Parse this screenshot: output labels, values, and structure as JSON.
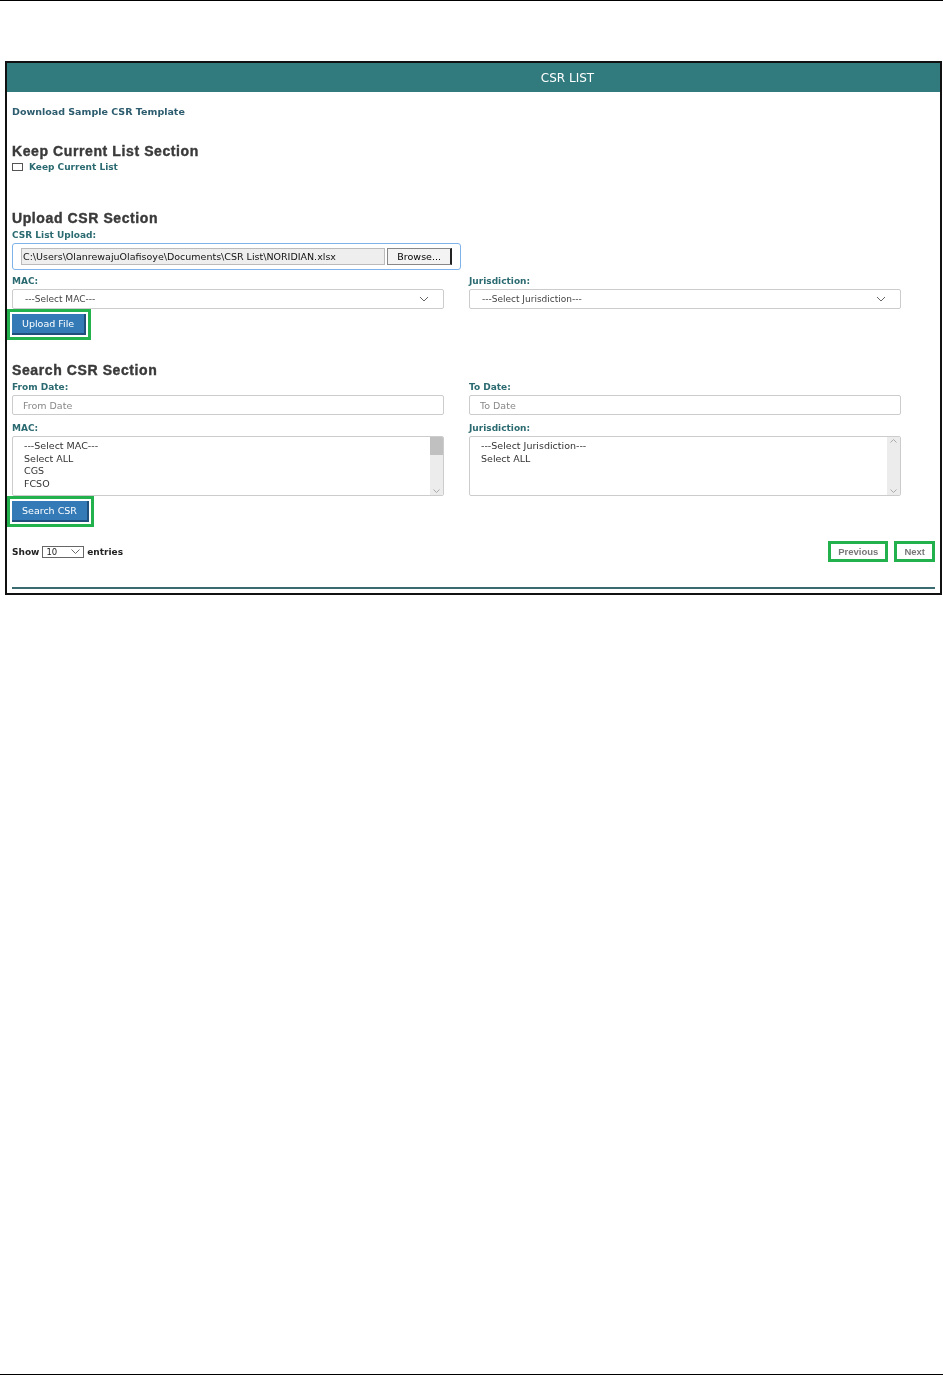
{
  "header": {
    "title": "CSR LIST"
  },
  "download_link": "Download Sample CSR Template",
  "keep_section": {
    "heading": "Keep Current List Section",
    "checkbox": {
      "label": "Keep Current List",
      "checked": false
    }
  },
  "upload_section": {
    "heading": "Upload CSR Section",
    "file_label": "CSR List Upload:",
    "file_path": "C:\\Users\\OlanrewajuOlafisoye\\Documents\\CSR List\\NORIDIAN.xlsx",
    "browse_button": "Browse...",
    "mac": {
      "label": "MAC:",
      "value": "---Select MAC---"
    },
    "jurisdiction": {
      "label": "Jurisdiction:",
      "value": "---Select Jurisdiction---"
    },
    "upload_button": {
      "label": "Upload File",
      "highlighted": true
    }
  },
  "search_section": {
    "heading": "Search CSR Section",
    "from_date": {
      "label": "From Date:",
      "placeholder": "From Date"
    },
    "to_date": {
      "label": "To Date:",
      "placeholder": "To Date"
    },
    "mac_list": {
      "label": "MAC:",
      "options": [
        "---Select MAC---",
        "Select ALL",
        "CGS",
        "FCSO"
      ]
    },
    "jurisdiction_list": {
      "label": "Jurisdiction:",
      "options": [
        "---Select Jurisdiction---",
        "Select ALL"
      ]
    },
    "search_button": {
      "label": "Search CSR",
      "highlighted": true
    }
  },
  "entries": {
    "prefix": "Show",
    "value": "10",
    "suffix": "entries"
  },
  "pagination": [
    {
      "label": "Previous",
      "highlighted": true
    },
    {
      "label": "Next",
      "highlighted": true
    }
  ]
}
